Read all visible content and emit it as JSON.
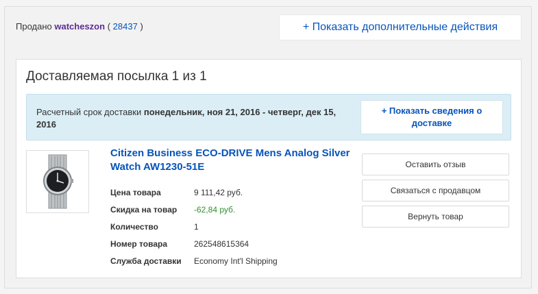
{
  "seller": {
    "prefix": "Продано",
    "name": "watcheszon",
    "open_paren": "(",
    "feedback": "28437",
    "close_paren": ")"
  },
  "more_actions_label": "+ Показать дополнительные действия",
  "package": {
    "title": "Доставляемая посылка 1 из 1",
    "delivery_prefix": "Расчетный срок доставки",
    "delivery_dates": "понедельник, ноя 21, 2016 - четверг, дек 15, 2016",
    "delivery_button": "+ Показать сведения о доставке"
  },
  "item": {
    "image_icon": "wristwatch-icon",
    "title": "Citizen Business ECO-DRIVE Mens Analog Silver Watch AW1230-51E",
    "details": [
      {
        "label": "Цена товара",
        "value": "9 111,42 руб."
      },
      {
        "label": "Скидка на товар",
        "value": "-62,84 руб."
      },
      {
        "label": "Количество",
        "value": "1"
      },
      {
        "label": "Номер товара",
        "value": "262548615364"
      },
      {
        "label": "Служба доставки",
        "value": "Economy Int'l Shipping"
      }
    ]
  },
  "actions": [
    {
      "label": "Оставить отзыв"
    },
    {
      "label": "Связаться с продавцом"
    },
    {
      "label": "Вернуть товар"
    }
  ],
  "colors": {
    "link": "#0654ba",
    "seller_name": "#5c2d91",
    "discount": "#2e8f2e",
    "delivery_bg": "#dbeef6"
  }
}
